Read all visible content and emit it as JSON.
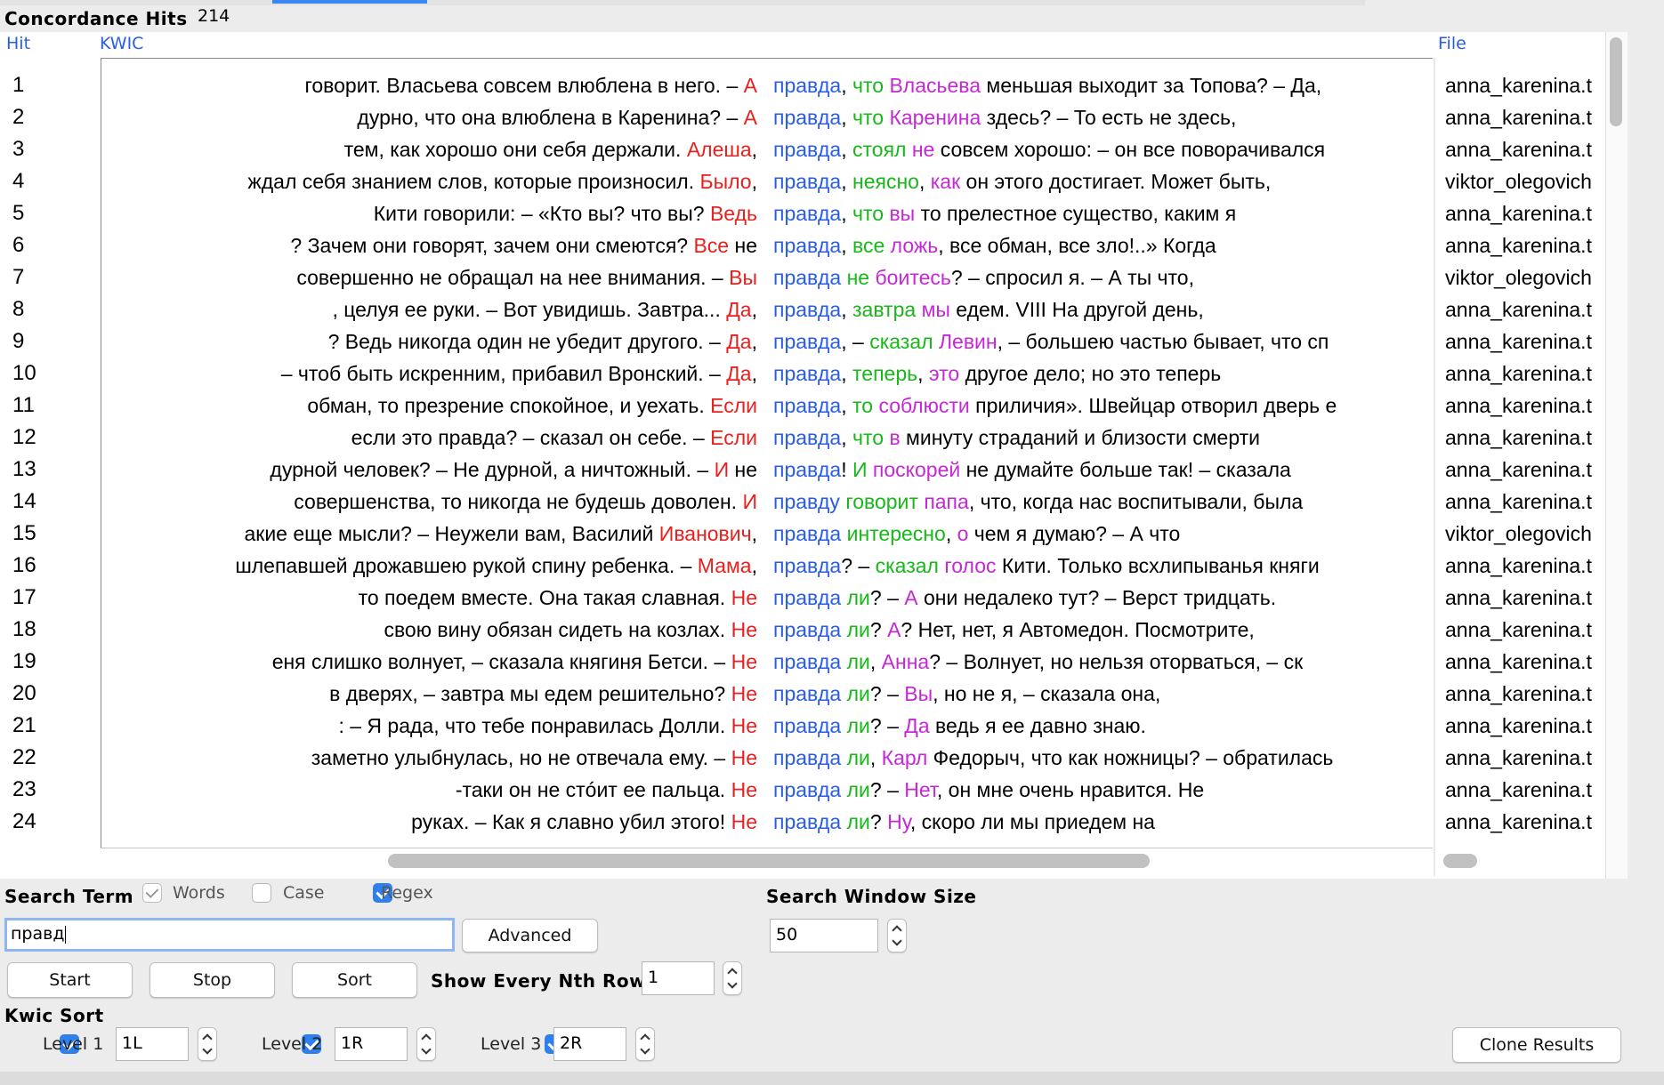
{
  "header": {
    "title": "Concordance Hits",
    "count": "214"
  },
  "columns": {
    "hit": "Hit",
    "kwic": "KWIC",
    "file": "File"
  },
  "colors": {
    "red": "#e8211f",
    "blue": "#2a5de6",
    "green": "#18b81a",
    "magenta": "#c529d6",
    "accent": "#2f80ed"
  },
  "rows": [
    {
      "hit": "1",
      "file": "anna_karenina.t",
      "left": [
        [
          "говорит. Власьева совсем влюблена в него.  – ",
          ""
        ],
        [
          "А",
          "red"
        ]
      ],
      "right": [
        [
          "правда",
          "blue"
        ],
        [
          ", ",
          ""
        ],
        [
          "что",
          "green"
        ],
        [
          " ",
          ""
        ],
        [
          "Власьева",
          "mag"
        ],
        [
          " меньшая выходит за Топова?  – Да,",
          ""
        ]
      ]
    },
    {
      "hit": "2",
      "file": "anna_karenina.t",
      "left": [
        [
          "дурно, что она влюблена в Каренина?  – ",
          ""
        ],
        [
          "А",
          "red"
        ]
      ],
      "right": [
        [
          "правда",
          "blue"
        ],
        [
          ", ",
          ""
        ],
        [
          "что",
          "green"
        ],
        [
          " ",
          ""
        ],
        [
          "Каренина",
          "mag"
        ],
        [
          " здесь?  – То есть не здесь,",
          ""
        ]
      ]
    },
    {
      "hit": "3",
      "file": "anna_karenina.t",
      "left": [
        [
          "тем, как хорошо они себя держали. ",
          ""
        ],
        [
          "Алеша",
          "red"
        ],
        [
          ",",
          ""
        ]
      ],
      "right": [
        [
          "правда",
          "blue"
        ],
        [
          ", ",
          ""
        ],
        [
          "стоял",
          "green"
        ],
        [
          " ",
          ""
        ],
        [
          "не",
          "mag"
        ],
        [
          " совсем хорошо: – он все поворачивался",
          ""
        ]
      ]
    },
    {
      "hit": "4",
      "file": "viktor_olegovich",
      "left": [
        [
          "ждал себя знанием слов, которые произносил. ",
          ""
        ],
        [
          "Было",
          "red"
        ],
        [
          ",",
          ""
        ]
      ],
      "right": [
        [
          "правда",
          "blue"
        ],
        [
          ", ",
          ""
        ],
        [
          "неясно",
          "green"
        ],
        [
          ", ",
          ""
        ],
        [
          "как",
          "mag"
        ],
        [
          " он этого достигает. Может быть,",
          ""
        ]
      ]
    },
    {
      "hit": "5",
      "file": "anna_karenina.t",
      "left": [
        [
          "Кити говорили: – «Кто вы? что вы? ",
          ""
        ],
        [
          "Ведь",
          "red"
        ]
      ],
      "right": [
        [
          "правда",
          "blue"
        ],
        [
          ", ",
          ""
        ],
        [
          "что",
          "green"
        ],
        [
          " ",
          ""
        ],
        [
          "вы",
          "mag"
        ],
        [
          " то прелестное существо, каким я",
          ""
        ]
      ]
    },
    {
      "hit": "6",
      "file": "anna_karenina.t",
      "left": [
        [
          "? Зачем они говорят, зачем они смеются? ",
          ""
        ],
        [
          "Все",
          "red"
        ],
        [
          " не",
          ""
        ]
      ],
      "right": [
        [
          "правда",
          "blue"
        ],
        [
          ", ",
          ""
        ],
        [
          "все",
          "green"
        ],
        [
          " ",
          ""
        ],
        [
          "ложь",
          "mag"
        ],
        [
          ", все обман, все зло!..»  Когда",
          ""
        ]
      ]
    },
    {
      "hit": "7",
      "file": "viktor_olegovich",
      "left": [
        [
          "совершенно не обращал на нее внимания.  – ",
          ""
        ],
        [
          "Вы",
          "red"
        ]
      ],
      "right": [
        [
          "правда",
          "blue"
        ],
        [
          " ",
          ""
        ],
        [
          "не",
          "green"
        ],
        [
          " ",
          ""
        ],
        [
          "боитесь",
          "mag"
        ],
        [
          "? – спросил я.  – А ты что,",
          ""
        ]
      ]
    },
    {
      "hit": "8",
      "file": "anna_karenina.t",
      "left": [
        [
          ", целуя ее руки. – Вот увидишь. Завтра... ",
          ""
        ],
        [
          "Да",
          "red"
        ],
        [
          ",",
          ""
        ]
      ],
      "right": [
        [
          "правда",
          "blue"
        ],
        [
          ", ",
          ""
        ],
        [
          "завтра",
          "green"
        ],
        [
          " ",
          ""
        ],
        [
          "мы",
          "mag"
        ],
        [
          " едем.      VIII    На другой день,",
          ""
        ]
      ]
    },
    {
      "hit": "9",
      "file": "anna_karenina.t",
      "left": [
        [
          "? Ведь никогда один не убедит другого.  – ",
          ""
        ],
        [
          "Да",
          "red"
        ],
        [
          ",",
          ""
        ]
      ],
      "right": [
        [
          "правда",
          "blue"
        ],
        [
          ", – ",
          ""
        ],
        [
          "сказал",
          "green"
        ],
        [
          " ",
          ""
        ],
        [
          "Левин",
          "mag"
        ],
        [
          ", – большею частью бывает, что сп",
          ""
        ]
      ]
    },
    {
      "hit": "10",
      "file": "anna_karenina.t",
      "left": [
        [
          "– чтоб быть искренним, прибавил Вронский.  – ",
          ""
        ],
        [
          "Да",
          "red"
        ],
        [
          ",",
          ""
        ]
      ],
      "right": [
        [
          "правда",
          "blue"
        ],
        [
          ", ",
          ""
        ],
        [
          "теперь",
          "green"
        ],
        [
          ", ",
          ""
        ],
        [
          "это",
          "mag"
        ],
        [
          " другое дело; но это теперь",
          ""
        ]
      ]
    },
    {
      "hit": "11",
      "file": "anna_karenina.t",
      "left": [
        [
          "обман, то презрение спокойное, и уехать. ",
          ""
        ],
        [
          "Если",
          "red"
        ]
      ],
      "right": [
        [
          "правда",
          "blue"
        ],
        [
          ", ",
          ""
        ],
        [
          "то",
          "green"
        ],
        [
          " ",
          ""
        ],
        [
          "соблюсти",
          "mag"
        ],
        [
          " приличия».  Швейцар отворил дверь е",
          ""
        ]
      ]
    },
    {
      "hit": "12",
      "file": "anna_karenina.t",
      "left": [
        [
          "если это правда? – сказал он себе. – ",
          ""
        ],
        [
          "Если",
          "red"
        ]
      ],
      "right": [
        [
          "правда",
          "blue"
        ],
        [
          ", ",
          ""
        ],
        [
          "что",
          "green"
        ],
        [
          " ",
          ""
        ],
        [
          "в",
          "mag"
        ],
        [
          " минуту страданий и близости смерти",
          ""
        ]
      ]
    },
    {
      "hit": "13",
      "file": "anna_karenina.t",
      "left": [
        [
          "дурной человек?  – Не дурной, а ничтожный.  – ",
          ""
        ],
        [
          "И",
          "red"
        ],
        [
          " не",
          ""
        ]
      ],
      "right": [
        [
          "правда",
          "blue"
        ],
        [
          "! ",
          ""
        ],
        [
          "И",
          "green"
        ],
        [
          " ",
          ""
        ],
        [
          "поскорей",
          "mag"
        ],
        [
          " не думайте больше так! – сказала",
          ""
        ]
      ]
    },
    {
      "hit": "14",
      "file": "anna_karenina.t",
      "left": [
        [
          "совершенства, то никогда не будешь доволен. ",
          ""
        ],
        [
          "И",
          "red"
        ]
      ],
      "right": [
        [
          "правду",
          "blue"
        ],
        [
          " ",
          ""
        ],
        [
          "говорит",
          "green"
        ],
        [
          " ",
          ""
        ],
        [
          "папа",
          "mag"
        ],
        [
          ", что, когда нас воспитывали, была",
          ""
        ]
      ]
    },
    {
      "hit": "15",
      "file": "viktor_olegovich",
      "left": [
        [
          "акие еще мысли?  – Неужели вам, Василий ",
          ""
        ],
        [
          "Иванович",
          "red"
        ],
        [
          ",",
          ""
        ]
      ],
      "right": [
        [
          "правда",
          "blue"
        ],
        [
          " ",
          ""
        ],
        [
          "интересно",
          "green"
        ],
        [
          ", ",
          ""
        ],
        [
          "о",
          "mag"
        ],
        [
          " чем я думаю?  – А что",
          ""
        ]
      ]
    },
    {
      "hit": "16",
      "file": "anna_karenina.t",
      "left": [
        [
          "шлепавшей дрожавшею рукой спину ребенка.  – ",
          ""
        ],
        [
          "Мама",
          "red"
        ],
        [
          ",",
          ""
        ]
      ],
      "right": [
        [
          "правда",
          "blue"
        ],
        [
          "? – ",
          ""
        ],
        [
          "сказал",
          "green"
        ],
        [
          " ",
          ""
        ],
        [
          "голос",
          "mag"
        ],
        [
          " Кити.  Только всхлипыванья княги",
          ""
        ]
      ]
    },
    {
      "hit": "17",
      "file": "anna_karenina.t",
      "left": [
        [
          "то поедем вместе. Она такая славная. ",
          ""
        ],
        [
          "Не",
          "red"
        ]
      ],
      "right": [
        [
          "правда",
          "blue"
        ],
        [
          " ",
          ""
        ],
        [
          "ли",
          "green"
        ],
        [
          "?  – ",
          ""
        ],
        [
          "А",
          "mag"
        ],
        [
          " они недалеко тут?  – Верст тридцать.",
          ""
        ]
      ]
    },
    {
      "hit": "18",
      "file": "anna_karenina.t",
      "left": [
        [
          "свою вину обязан сидеть на козлах. ",
          ""
        ],
        [
          "Не",
          "red"
        ]
      ],
      "right": [
        [
          "правда",
          "blue"
        ],
        [
          " ",
          ""
        ],
        [
          "ли",
          "green"
        ],
        [
          "? ",
          ""
        ],
        [
          "А",
          "mag"
        ],
        [
          "? Нет, нет, я Автомедон. Посмотрите,",
          ""
        ]
      ]
    },
    {
      "hit": "19",
      "file": "anna_karenina.t",
      "left": [
        [
          "еня слишко волнует, – сказала княгиня Бетси. – ",
          ""
        ],
        [
          "Не",
          "red"
        ]
      ],
      "right": [
        [
          "правда",
          "blue"
        ],
        [
          " ",
          ""
        ],
        [
          "ли",
          "green"
        ],
        [
          ", ",
          ""
        ],
        [
          "Анна",
          "mag"
        ],
        [
          "?  – Волнует, но нельзя оторваться, – ск",
          ""
        ]
      ]
    },
    {
      "hit": "20",
      "file": "anna_karenina.t",
      "left": [
        [
          "в дверях, – завтра мы едем решительно? ",
          ""
        ],
        [
          "Не",
          "red"
        ]
      ],
      "right": [
        [
          "правда",
          "blue"
        ],
        [
          " ",
          ""
        ],
        [
          "ли",
          "green"
        ],
        [
          "?  – ",
          ""
        ],
        [
          "Вы",
          "mag"
        ],
        [
          ", но не я, – сказала она,",
          ""
        ]
      ]
    },
    {
      "hit": "21",
      "file": "anna_karenina.t",
      "left": [
        [
          ":  – Я рада, что тебе понравилась Долли. ",
          ""
        ],
        [
          "Не",
          "red"
        ]
      ],
      "right": [
        [
          "правда",
          "blue"
        ],
        [
          " ",
          ""
        ],
        [
          "ли",
          "green"
        ],
        [
          "?  – ",
          ""
        ],
        [
          "Да",
          "mag"
        ],
        [
          " ведь я ее давно знаю.",
          ""
        ]
      ]
    },
    {
      "hit": "22",
      "file": "anna_karenina.t",
      "left": [
        [
          "заметно улыбнулась, но не отвечала ему.  – ",
          ""
        ],
        [
          "Не",
          "red"
        ]
      ],
      "right": [
        [
          "правда",
          "blue"
        ],
        [
          " ",
          ""
        ],
        [
          "ли",
          "green"
        ],
        [
          ", ",
          ""
        ],
        [
          "Карл",
          "mag"
        ],
        [
          " Федорыч, что как ножницы? – обратилась",
          ""
        ]
      ]
    },
    {
      "hit": "23",
      "file": "anna_karenina.t",
      "left": [
        [
          "-таки он не стóит ее пальца. ",
          ""
        ],
        [
          "Не",
          "red"
        ]
      ],
      "right": [
        [
          "правда",
          "blue"
        ],
        [
          " ",
          ""
        ],
        [
          "ли",
          "green"
        ],
        [
          "?  – ",
          ""
        ],
        [
          "Нет",
          "mag"
        ],
        [
          ", он мне очень нравится. Не",
          ""
        ]
      ]
    },
    {
      "hit": "24",
      "file": "anna_karenina.t",
      "left": [
        [
          "руках. – Как я славно убил этого! ",
          ""
        ],
        [
          "Не",
          "red"
        ]
      ],
      "right": [
        [
          "правда",
          "blue"
        ],
        [
          " ",
          ""
        ],
        [
          "ли",
          "green"
        ],
        [
          "? ",
          ""
        ],
        [
          "Ну",
          "mag"
        ],
        [
          ", скоро ли мы приедем на",
          ""
        ]
      ]
    }
  ],
  "search": {
    "label": "Search Term",
    "words_label": "Words",
    "words_checked": true,
    "case_label": "Case",
    "case_checked": false,
    "regex_label": "Regex",
    "regex_checked": true,
    "value": "правд",
    "advanced_button": "Advanced",
    "window_label": "Search Window Size",
    "window_value": "50"
  },
  "controls": {
    "start": "Start",
    "stop": "Stop",
    "sort": "Sort",
    "nth_label": "Show Every Nth Row",
    "nth_value": "1"
  },
  "kwic_sort": {
    "label": "Kwic Sort",
    "levels": [
      {
        "label": "Level 1",
        "value": "1L",
        "checked": true
      },
      {
        "label": "Level 2",
        "value": "1R",
        "checked": true
      },
      {
        "label": "Level 3",
        "value": "2R",
        "checked": true
      }
    ],
    "clone_button": "Clone Results"
  }
}
